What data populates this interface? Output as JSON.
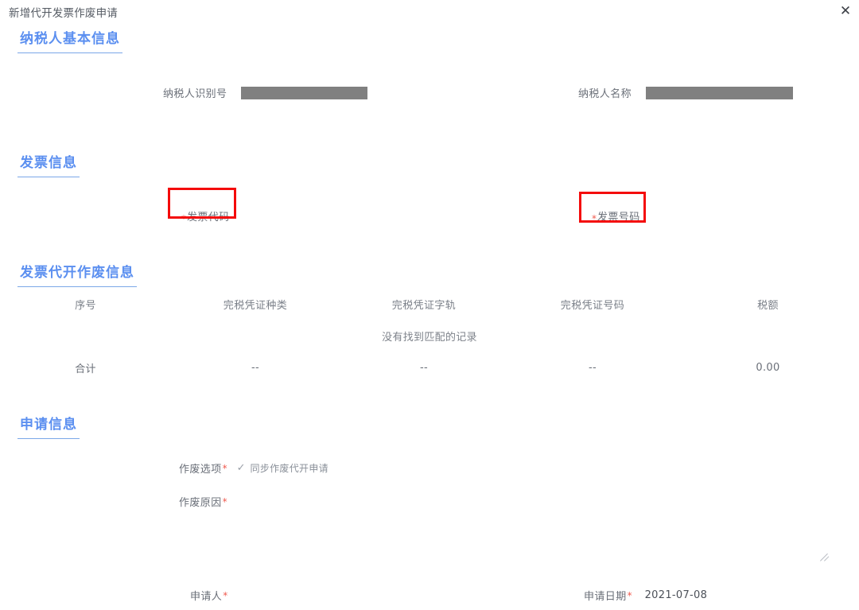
{
  "window": {
    "title": "新增代开发票作废申请",
    "close_icon": "close-icon",
    "close_glyph": "✕"
  },
  "colors": {
    "section_heading": "#5b8ff0",
    "section_rule": "#7ba7e8",
    "highlight_box": "#f40b0b",
    "required_star": "#f05a4f",
    "redaction": "#808080",
    "label_text": "#6a6f78"
  },
  "sections": {
    "taxpayer": {
      "heading": "纳税人基本信息",
      "fields": [
        {
          "label": "纳税人识别号",
          "value": "",
          "redacted": true
        },
        {
          "label": "纳税人名称",
          "value": "",
          "redacted": true
        }
      ]
    },
    "invoice": {
      "heading": "发票信息",
      "fields": [
        {
          "label": "发票代码",
          "required": true,
          "highlighted": true,
          "value": ""
        },
        {
          "label": "发票号码",
          "required": true,
          "highlighted": true,
          "value": ""
        }
      ]
    },
    "void_info": {
      "heading": "发票代开作废信息",
      "table": {
        "columns": [
          "序号",
          "完税凭证种类",
          "完税凭证字轨",
          "完税凭证号码",
          "税额"
        ],
        "rows": [],
        "empty_text": "没有找到匹配的记录",
        "total_row": [
          "合计",
          "--",
          "--",
          "--",
          "0.00"
        ]
      }
    },
    "application": {
      "heading": "申请信息",
      "void_option": {
        "label": "作废选项",
        "required": true,
        "checkbox": {
          "checked": true,
          "check_glyph": "✓",
          "label": "同步作废代开申请"
        }
      },
      "void_reason": {
        "label": "作废原因",
        "required": true,
        "value": "",
        "placeholder": ""
      },
      "applicant": {
        "label": "申请人",
        "required": true,
        "value": ""
      },
      "apply_date": {
        "label": "申请日期",
        "required": true,
        "value": "2021-07-08"
      }
    }
  }
}
